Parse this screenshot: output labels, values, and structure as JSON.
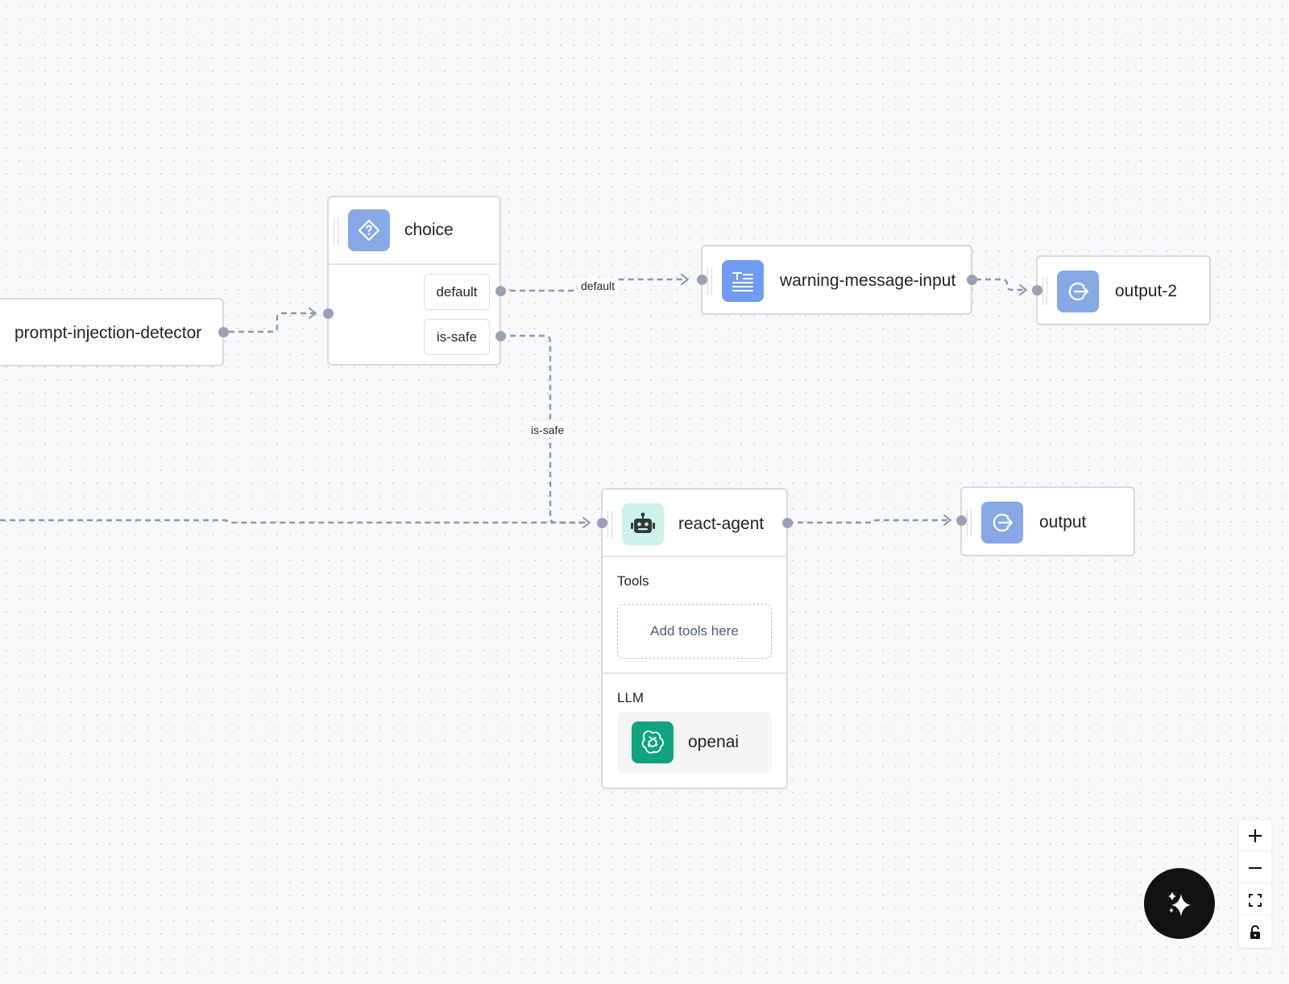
{
  "nodes": {
    "prompt_injection_detector": {
      "title": "prompt-injection-detector"
    },
    "choice": {
      "title": "choice",
      "icon": "diamond-question-icon",
      "routes": [
        "default",
        "is-safe"
      ]
    },
    "warning_message_input": {
      "title": "warning-message-input",
      "icon": "text-lines-icon"
    },
    "output_2": {
      "title": "output-2",
      "icon": "exit-arrow-icon"
    },
    "react_agent": {
      "title": "react-agent",
      "icon": "robot-icon",
      "tools_label": "Tools",
      "tools_placeholder": "Add tools here",
      "llm_label": "LLM",
      "llm_name": "openai",
      "llm_icon": "openai-logo-icon"
    },
    "output": {
      "title": "output",
      "icon": "exit-arrow-icon"
    }
  },
  "edges": {
    "default_label": "default",
    "is_safe_label": "is-safe"
  },
  "controls": {
    "zoom_in": "plus-icon",
    "zoom_out": "minus-icon",
    "fit_view": "fit-view-icon",
    "lock": "lock-icon",
    "assistant": "sparkles-icon"
  },
  "colors": {
    "edge": "#8e97ae",
    "icon_blue": "#86a9e6",
    "icon_blue_strong": "#6f9cf0",
    "icon_mint": "#cdf2ea",
    "openai_green": "#10a37f",
    "assistant_button": "#111214"
  }
}
